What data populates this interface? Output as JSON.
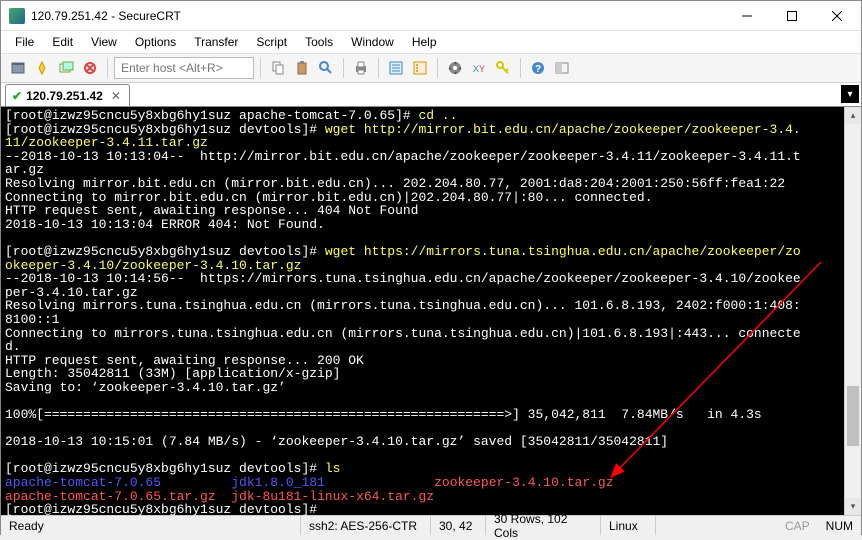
{
  "window": {
    "title": "120.79.251.42 - SecureCRT"
  },
  "menu": {
    "file": "File",
    "edit": "Edit",
    "view": "View",
    "options": "Options",
    "transfer": "Transfer",
    "script": "Script",
    "tools": "Tools",
    "window": "Window",
    "help": "Help"
  },
  "toolbar": {
    "host_placeholder": "Enter host <Alt+R>"
  },
  "tab": {
    "label": "120.79.251.42"
  },
  "terminal": {
    "l1a": "[root@izwz95cncu5y8xbg6hy1suz apache-tomcat-7.0.65]# ",
    "l1b": "cd ..",
    "l2a": "[root@izwz95cncu5y8xbg6hy1suz devtools]# ",
    "l2b": "wget http://mirror.bit.edu.cn/apache/zookeeper/zookeeper-3.4.",
    "l3": "11/zookeeper-3.4.11.tar.gz",
    "l4": "--2018-10-13 10:13:04--  http://mirror.bit.edu.cn/apache/zookeeper/zookeeper-3.4.11/zookeeper-3.4.11.t",
    "l5": "ar.gz",
    "l6": "Resolving mirror.bit.edu.cn (mirror.bit.edu.cn)... 202.204.80.77, 2001:da8:204:2001:250:56ff:fea1:22",
    "l7": "Connecting to mirror.bit.edu.cn (mirror.bit.edu.cn)|202.204.80.77|:80... connected.",
    "l8": "HTTP request sent, awaiting response... 404 Not Found",
    "l9": "2018-10-13 10:13:04 ERROR 404: Not Found.",
    "l10": "",
    "l11a": "[root@izwz95cncu5y8xbg6hy1suz devtools]# ",
    "l11b": "wget https://mirrors.tuna.tsinghua.edu.cn/apache/zookeeper/zo",
    "l12": "okeeper-3.4.10/zookeeper-3.4.10.tar.gz",
    "l13": "--2018-10-13 10:14:56--  https://mirrors.tuna.tsinghua.edu.cn/apache/zookeeper/zookeeper-3.4.10/zookee",
    "l14": "per-3.4.10.tar.gz",
    "l15": "Resolving mirrors.tuna.tsinghua.edu.cn (mirrors.tuna.tsinghua.edu.cn)... 101.6.8.193, 2402:f000:1:408:",
    "l16": "8100::1",
    "l17": "Connecting to mirrors.tuna.tsinghua.edu.cn (mirrors.tuna.tsinghua.edu.cn)|101.6.8.193|:443... connecte",
    "l18": "d.",
    "l19": "HTTP request sent, awaiting response... 200 OK",
    "l20": "Length: 35042811 (33M) [application/x-gzip]",
    "l21": "Saving to: ‘zookeeper-3.4.10.tar.gz’",
    "l22": "",
    "l23": "100%[===========================================================>] 35,042,811  7.84MB/s   in 4.3s",
    "l24": "",
    "l25": "2018-10-13 10:15:01 (7.84 MB/s) - ‘zookeeper-3.4.10.tar.gz’ saved [35042811/35042811]",
    "l26": "",
    "l27a": "[root@izwz95cncu5y8xbg6hy1suz devtools]# ",
    "l27b": "ls",
    "l28a": "apache-tomcat-7.0.65",
    "l28b": "         ",
    "l28c": "jdk1.8.0_181",
    "l28d": "              ",
    "l28e": "zookeeper-3.4.10.tar.gz",
    "l29a": "apache-tomcat-7.0.65.tar.gz",
    "l29b": "  ",
    "l29c": "jdk-8u181-linux-x64.tar.gz",
    "l30": "[root@izwz95cncu5y8xbg6hy1suz devtools]# "
  },
  "status": {
    "ready": "Ready",
    "cipher": "ssh2: AES-256-CTR",
    "pos": "30,  42",
    "dims": "30 Rows, 102 Cols",
    "os": "Linux",
    "cap": "CAP",
    "num": "NUM"
  }
}
